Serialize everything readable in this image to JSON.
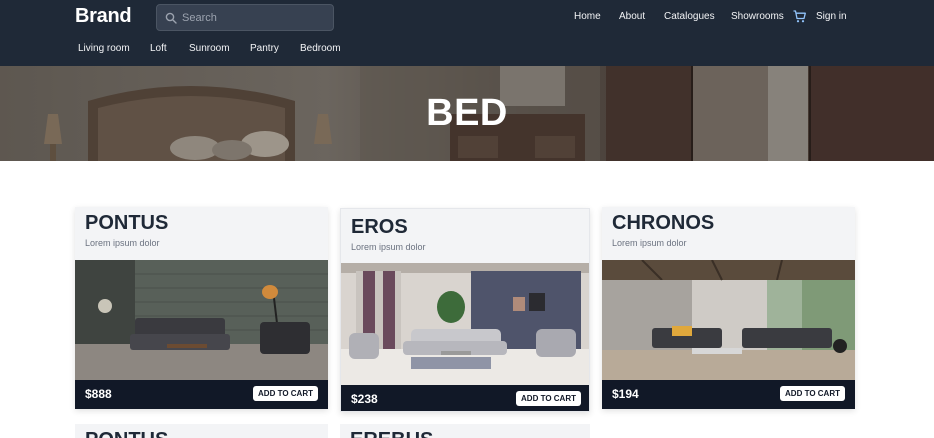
{
  "header": {
    "brand": "Brand",
    "search_placeholder": "Search",
    "nav": [
      "Home",
      "About",
      "Catalogues",
      "Showrooms"
    ],
    "sign_in": "Sign in",
    "categories": [
      "Living room",
      "Loft",
      "Sunroom",
      "Pantry",
      "Bedroom"
    ]
  },
  "hero": {
    "title": "BED"
  },
  "products": [
    {
      "name": "PONTUS",
      "subtitle": "Lorem ipsum dolor",
      "price": "$888",
      "button": "ADD TO CART"
    },
    {
      "name": "EROS",
      "subtitle": "Lorem ipsum dolor",
      "price": "$238",
      "button": "ADD TO CART"
    },
    {
      "name": "CHRONOS",
      "subtitle": "Lorem ipsum dolor",
      "price": "$194",
      "button": "ADD TO CART"
    }
  ],
  "next_row": [
    "PONTUS",
    "EREBUS"
  ],
  "colors": {
    "header_bg": "#1f2937",
    "card_bg": "#f3f4f6",
    "footer_bg": "#111827"
  }
}
